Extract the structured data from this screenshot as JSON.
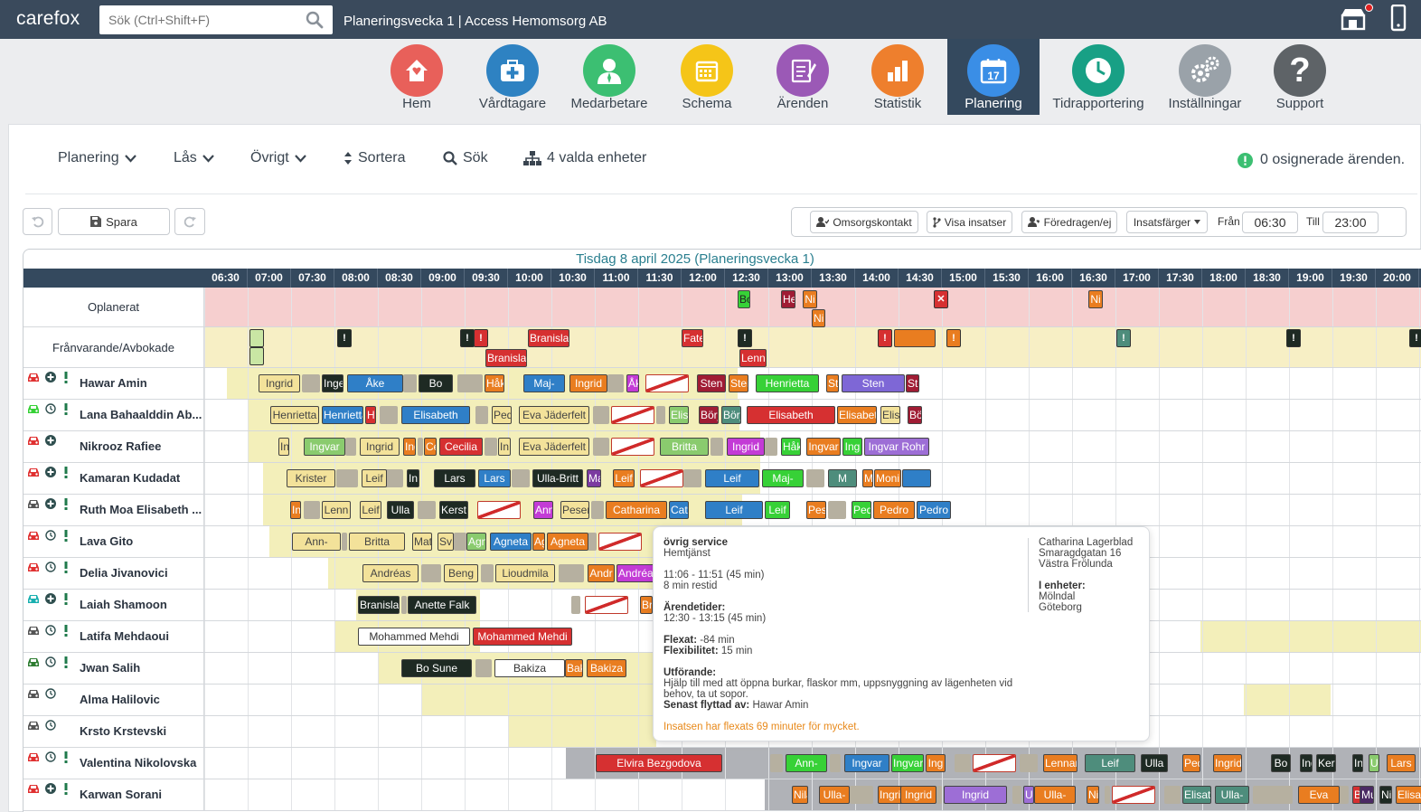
{
  "topbar": {
    "logo": "carefox",
    "search_placeholder": "Sök (Ctrl+Shift+F)",
    "title": "Planeringsvecka 1 | Access Hemomsorg AB"
  },
  "nav": [
    {
      "label": "Hem",
      "color": "#e8605a",
      "icon": "home-icon"
    },
    {
      "label": "Vårdtagare",
      "color": "#2e82c2",
      "icon": "medical-kit-icon"
    },
    {
      "label": "Medarbetare",
      "color": "#3cbf72",
      "icon": "person-icon"
    },
    {
      "label": "Schema",
      "color": "#f5c518",
      "icon": "calendar-icon"
    },
    {
      "label": "Ärenden",
      "color": "#9b59b6",
      "icon": "notepad-icon"
    },
    {
      "label": "Statistik",
      "color": "#ee7f2d",
      "icon": "bar-chart-icon"
    },
    {
      "label": "Planering",
      "color": "#3a8ee6",
      "icon": "calendar-17-icon",
      "active": true
    },
    {
      "label": "Tidrapportering",
      "color": "#18a085",
      "icon": "clock-icon"
    },
    {
      "label": "Inställningar",
      "color": "#9aa2a9",
      "icon": "gears-icon"
    },
    {
      "label": "Support",
      "color": "#5e6367",
      "icon": "question-icon"
    }
  ],
  "toolbar": {
    "planering": "Planering",
    "las": "Lås",
    "ovrigt": "Övrigt",
    "sortera": "Sortera",
    "sok": "Sök",
    "enheter": "4 valda enheter",
    "osignerade": "0 osignerade ärenden."
  },
  "actions": {
    "spara": "Spara",
    "omsorgskontakt": "Omsorgskontakt",
    "visa_insatser": "Visa insatser",
    "foredragen": "Föredragen/ej",
    "insatsfarger": "Insatsfärger",
    "fran_label": "Från",
    "fran_value": "06:30",
    "till_label": "Till",
    "till_value": "23:00"
  },
  "schedule": {
    "day_title": "Tisdag 8 april 2025 (Planeringsvecka 1)",
    "times": [
      "06:30",
      "07:00",
      "07:30",
      "08:00",
      "08:30",
      "09:00",
      "09:30",
      "10:00",
      "10:30",
      "11:00",
      "11:30",
      "12:00",
      "12:30",
      "13:00",
      "13:30",
      "14:00",
      "14:30",
      "15:00",
      "15:30",
      "16:00",
      "16:30",
      "17:00",
      "17:30",
      "18:00",
      "18:30",
      "19:00",
      "19:30",
      "20:00"
    ],
    "oplanerat_label": "Oplanerat",
    "franvarande_label": "Frånvarande/Avbokade",
    "oplanerat_items": [
      "Bo",
      "He",
      "Ni",
      "Ni",
      "Ni"
    ],
    "franvarande_items": [
      "Branisla",
      "Branisla",
      "Fate",
      "Lenn"
    ],
    "employees": [
      {
        "name": "Hawar Amin",
        "car": "#e03131",
        "icons": [
          "plus",
          "excl"
        ],
        "blocks": [
          "Ingrid",
          "Inge",
          "Åke",
          "Bo",
          "Håk",
          "Maj-",
          "Ingrid",
          "Åk",
          "Sten",
          "Sten",
          "Henrietta",
          "Ste",
          "Sten",
          "Ste"
        ]
      },
      {
        "name": "Lana Bahaalddin Ab...",
        "car": "#37d137",
        "icons": [
          "clock",
          "excl"
        ],
        "blocks": [
          "Henrietta",
          "Henrietta",
          "He",
          "Elisabeth",
          "Ped",
          "Eva Jäderfelt",
          "Elis",
          "Börj",
          "Börj",
          "Elisabeth",
          "Elisabet",
          "Elis",
          "Bö"
        ]
      },
      {
        "name": "Nikrooz Rafiee",
        "car": "#e03131",
        "icons": [
          "plus"
        ],
        "blocks": [
          "In",
          "Ingvar",
          "Ingrid",
          "Ing",
          "Ce",
          "Cecilia",
          "In",
          "Eva Jäderfelt",
          "Britta",
          "Ingrid",
          "Håk",
          "Ingvar",
          "Ing",
          "Ingvar Rohr"
        ]
      },
      {
        "name": "Kamaran Kudadat",
        "car": "#e03131",
        "icons": [
          "plus",
          "excl"
        ],
        "blocks": [
          "Krister",
          "Leif",
          "In",
          "Lars",
          "Lars",
          "Ulla-Britt",
          "Ma",
          "Leif",
          "Leif",
          "Maj-",
          "M",
          "Moni",
          "Moni"
        ]
      },
      {
        "name": "Ruth Moa Elisabeth ...",
        "car": "#555555",
        "icons": [
          "plus",
          "excl"
        ],
        "blocks": [
          "In",
          "Lenn",
          "Leif",
          "Ulla",
          "Kerst",
          "Ann",
          "Peser",
          "Catharina",
          "Cat",
          "Leif",
          "Leif",
          "Pes",
          "Ped",
          "Pedro",
          "Pedro"
        ]
      },
      {
        "name": "Lava Gito",
        "car": "#e03131",
        "icons": [
          "clock",
          "excl"
        ],
        "blocks": [
          "Ann-",
          "Britta",
          "Mat",
          "Sv",
          "Agn",
          "Agneta",
          "Ag",
          "Agneta"
        ]
      },
      {
        "name": "Delia Jivanovici",
        "car": "#e03131",
        "icons": [
          "clock",
          "excl"
        ],
        "blocks": [
          "Andréas",
          "Beng",
          "Lioudmila",
          "Andr",
          "Andréa"
        ]
      },
      {
        "name": "Laiah Shamoon",
        "car": "#1ab0b0",
        "icons": [
          "plus",
          "excl"
        ],
        "blocks": [
          "Branisla",
          "Anette Falk",
          "Br"
        ]
      },
      {
        "name": "Latifa Mehdaoui",
        "car": "#555555",
        "icons": [
          "clock",
          "excl"
        ],
        "blocks": [
          "Mohammed Mehdi",
          "Mohammed Mehdi"
        ]
      },
      {
        "name": "Jwan Salih",
        "car": "#2e7d32",
        "icons": [
          "clock",
          "excl"
        ],
        "blocks": [
          "Bo Sune",
          "Bakiza",
          "Bak",
          "Bakiza"
        ]
      },
      {
        "name": "Alma Halilovic",
        "car": "#555555",
        "icons": [
          "clock"
        ],
        "blocks": []
      },
      {
        "name": "Krsto Krstevski",
        "car": "#555555",
        "icons": [
          "clock"
        ],
        "blocks": []
      },
      {
        "name": "Valentina Nikolovska",
        "car": "#e03131",
        "icons": [
          "clock",
          "excl"
        ],
        "blocks": [
          "Elvira Bezgodova",
          "Ann-",
          "Ingvar",
          "Ingvar",
          "Ing",
          "Lennar",
          "Leif",
          "Ulla",
          "Ped",
          "Ingrid",
          "Bo",
          "Ing",
          "Kers",
          "In",
          "Ul",
          "Lars"
        ]
      },
      {
        "name": "Karwan Sorani",
        "car": "#e03131",
        "icons": [
          "plus",
          "excl"
        ],
        "blocks": [
          "Nila",
          "Ulla-",
          "Ingrid",
          "Ingrid",
          "Ingrid",
          "Ul",
          "Ulla-",
          "Ni",
          "Elisat",
          "Ulla-",
          "Eva",
          "Bak",
          "Mu",
          "Ni",
          "Elisat"
        ]
      }
    ]
  },
  "tooltip": {
    "type": "övrig service",
    "category": "Hemtjänst",
    "time": "11:06 - 11:51 (45 min)",
    "restid": "8 min restid",
    "arendetider_label": "Ärendetider:",
    "arendetider": "12:30 - 13:15 (45 min)",
    "flexat_label": "Flexat:",
    "flexat": "-84 min",
    "flexibilitet_label": "Flexibilitet:",
    "flexibilitet": "15 min",
    "utforande_label": "Utförande:",
    "utforande": "Hjälp till med att öppna burkar, flaskor mm, uppsnyggning av lägenheten vid behov, ta ut sopor.",
    "senast_label": "Senast flyttad av:",
    "senast": "Hawar Amin",
    "warning": "Insatsen har flexats 69 minuter för mycket.",
    "client_name": "Catharina Lagerblad",
    "client_street": "Smaragdgatan 16",
    "client_city": "Västra Frölunda",
    "enheter_label": "I enheter:",
    "enhet1": "Mölndal",
    "enhet2": "Göteborg"
  }
}
